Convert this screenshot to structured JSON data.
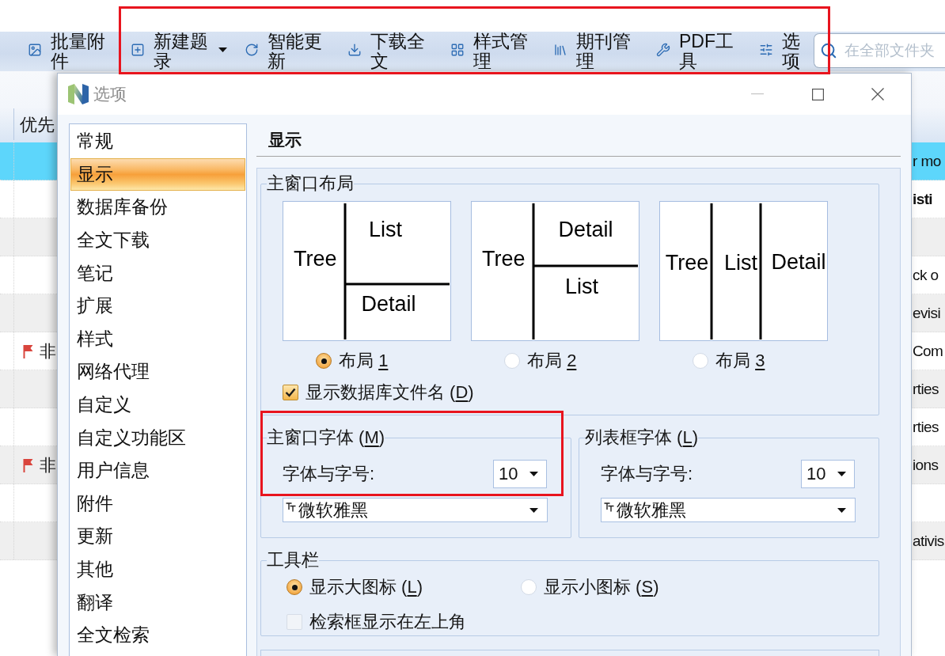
{
  "top_toolbar": {
    "items": [
      {
        "label": "批量附件",
        "dropdown": false
      },
      {
        "label": "新建题录",
        "dropdown": true
      },
      {
        "label": "智能更新",
        "dropdown": false
      },
      {
        "label": "下载全文",
        "dropdown": false
      },
      {
        "label": "样式管理",
        "dropdown": false
      },
      {
        "label": "期刊管理",
        "dropdown": false
      },
      {
        "label": "PDF工具",
        "dropdown": false
      },
      {
        "label": "选项",
        "dropdown": false
      }
    ],
    "search": {
      "placeholder": "在全部文件夹"
    }
  },
  "reference_list": {
    "columns": [
      "优先"
    ],
    "rows": [
      {
        "selected": true,
        "flagged": false,
        "unread": false,
        "title": "r mo"
      },
      {
        "selected": false,
        "flagged": false,
        "unread": true,
        "title": "isti"
      },
      {
        "selected": false,
        "flagged": false
      },
      {
        "selected": false,
        "flagged": false,
        "unread": false,
        "title": "ck o"
      },
      {
        "selected": false,
        "flagged": false,
        "unread": false,
        "title": "evisi"
      },
      {
        "selected": false,
        "flagged": true,
        "unread": false,
        "priority": "非",
        "title": "Com"
      },
      {
        "selected": false,
        "flagged": false,
        "unread": false,
        "title": "rties"
      },
      {
        "selected": false,
        "flagged": false,
        "unread": false,
        "title": "rties"
      },
      {
        "selected": false,
        "flagged": true,
        "unread": false,
        "priority": "非",
        "title": "ions"
      },
      {
        "selected": false,
        "flagged": false
      },
      {
        "selected": false,
        "flagged": false,
        "unread": false,
        "title": "ativis"
      }
    ]
  },
  "options_dialog": {
    "title": "选项",
    "nav_items": [
      {
        "label": "常规",
        "selected": false
      },
      {
        "label": "显示",
        "selected": true
      },
      {
        "label": "数据库备份",
        "selected": false
      },
      {
        "label": "全文下载",
        "selected": false
      },
      {
        "label": "笔记",
        "selected": false
      },
      {
        "label": "扩展",
        "selected": false
      },
      {
        "label": "样式",
        "selected": false
      },
      {
        "label": "网络代理",
        "selected": false
      },
      {
        "label": "自定义",
        "selected": false
      },
      {
        "label": "自定义功能区",
        "selected": false
      },
      {
        "label": "用户信息",
        "selected": false
      },
      {
        "label": "附件",
        "selected": false
      },
      {
        "label": "更新",
        "selected": false
      },
      {
        "label": "其他",
        "selected": false
      },
      {
        "label": "翻译",
        "selected": false
      },
      {
        "label": "全文检索",
        "selected": false
      }
    ],
    "page_title": "显示",
    "layout_group": {
      "legend": "主窗口布局",
      "layouts": [
        {
          "kind": "list_over_detail",
          "panes": [
            "Tree",
            "List",
            "Detail"
          ],
          "label": "布局 ",
          "access_key": "1",
          "selected": true
        },
        {
          "kind": "detail_over_list",
          "panes": [
            "Tree",
            "Detail",
            "List"
          ],
          "label": "布局 ",
          "access_key": "2",
          "selected": false
        },
        {
          "kind": "three_columns",
          "panes": [
            "Tree",
            "List",
            "Detail"
          ],
          "label": "布局 ",
          "access_key": "3",
          "selected": false
        }
      ],
      "show_db_filename": {
        "label": "显示数据库文件名 (",
        "access_key": "D",
        "label_end": ")",
        "checked": true
      }
    },
    "font_groups": [
      {
        "label": "主窗口字体 (",
        "access_key": "M",
        "label_end": ")",
        "size_label": "字体与字号:",
        "size": "10",
        "font": "微软雅黑"
      },
      {
        "label": "列表框字体 (",
        "access_key": "L",
        "label_end": ")",
        "size_label": "字体与字号:",
        "size": "10",
        "font": "微软雅黑"
      }
    ],
    "toolbar_group": {
      "legend": "工具栏",
      "icon_sizes": [
        {
          "label": "显示大图标 (",
          "access_key": "L",
          "label_end": ")",
          "selected": true
        },
        {
          "label": "显示小图标 (",
          "access_key": "S",
          "label_end": ")",
          "selected": false
        }
      ],
      "search_top_left": {
        "label": "检索框显示在左上角",
        "checked": false
      }
    }
  },
  "annotations": [
    {
      "kind": "highlight_frame"
    },
    {
      "kind": "highlight_frame"
    }
  ]
}
